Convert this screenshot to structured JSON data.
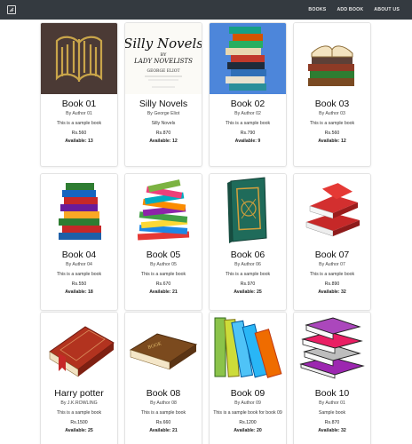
{
  "nav": {
    "links": [
      "BOOKS",
      "ADD BOOK",
      "ABOUT US"
    ]
  },
  "books": [
    {
      "title": "Book 01",
      "author": "By Author 01",
      "desc": "This is a sample book",
      "price": "Rs.560",
      "available": "Available: 13"
    },
    {
      "title": "Silly Novels",
      "author": "By George Eliot",
      "desc": "Silly Novels",
      "price": "Rs.870",
      "available": "Available: 12"
    },
    {
      "title": "Book 02",
      "author": "By Author 02",
      "desc": "This is a sample book",
      "price": "Rs.790",
      "available": "Available: 9"
    },
    {
      "title": "Book 03",
      "author": "By Author 03",
      "desc": "This is a sample book",
      "price": "Rs.560",
      "available": "Available: 12"
    },
    {
      "title": "Book 04",
      "author": "By Author 04",
      "desc": "This is a sample book",
      "price": "Rs.550",
      "available": "Available: 18"
    },
    {
      "title": "Book 05",
      "author": "By Author 05",
      "desc": "This is a sample book",
      "price": "Rs.670",
      "available": "Available: 21"
    },
    {
      "title": "Book 06",
      "author": "By Author 06",
      "desc": "This is a sample book",
      "price": "Rs.970",
      "available": "Available: 25"
    },
    {
      "title": "Book 07",
      "author": "By Author 07",
      "desc": "This is a sample book",
      "price": "Rs.890",
      "available": "Available: 32"
    },
    {
      "title": "Harry potter",
      "author": "By J.K.ROWLING",
      "desc": "This is a sample book",
      "price": "Rs.1500",
      "available": "Available: 25"
    },
    {
      "title": "Book 08",
      "author": "By Author 08",
      "desc": "This is a sample book",
      "price": "Rs.660",
      "available": "Available: 21"
    },
    {
      "title": "Book 09",
      "author": "By Author 09",
      "desc": "This is a sample book for book 09",
      "price": "Rs.1200",
      "available": "Available: 20"
    },
    {
      "title": "Book 10",
      "author": "By Author 01",
      "desc": "Sample book",
      "price": "Rs.870",
      "available": "Available: 32"
    }
  ],
  "cover_text": {
    "silly_title": "Silly Novels",
    "silly_by": "BY",
    "silly_lady": "LADY NOVELISTS",
    "silly_author": "GEORGE ELIOT",
    "book08_spine": "BOOK"
  }
}
